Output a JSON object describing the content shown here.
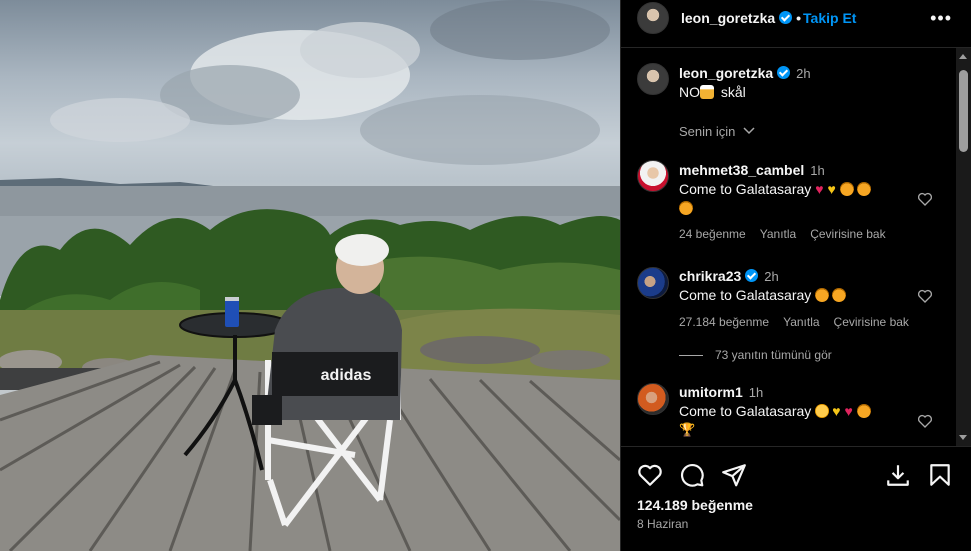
{
  "header": {
    "username": "leon_goretzka",
    "separator": "•",
    "follow_label": "Takip Et",
    "more": "•••"
  },
  "caption": {
    "username": "leon_goretzka",
    "time": "2h",
    "text_prefix": "NO",
    "text_suffix": "skål"
  },
  "sort_label": "Senin için",
  "comments": [
    {
      "username": "mehmet38_cambel",
      "time": "1h",
      "text": "Come to Galatasaray",
      "likes": "24 beğenme",
      "reply": "Yanıtla",
      "translate": "Çevirisine bak"
    },
    {
      "username": "chrikra23",
      "time": "2h",
      "text": "Come to Galatasaray",
      "likes": "27.184 beğenme",
      "reply": "Yanıtla",
      "translate": "Çevirisine bak"
    },
    {
      "username": "umitorm1",
      "time": "1h",
      "text": "Come to Galatasaray"
    }
  ],
  "view_replies": "73 yanıtın tümünü gör",
  "footer": {
    "likes": "124.189 beğenme",
    "date": "8 Haziran"
  },
  "colors": {
    "accent": "#0095f6",
    "background": "#000000",
    "muted_text": "#a8a8a8"
  },
  "icons": [
    "heart-icon",
    "comment-icon",
    "share-icon",
    "download-icon",
    "bookmark-icon",
    "verified-icon",
    "more-icon",
    "chevron-down-icon"
  ]
}
